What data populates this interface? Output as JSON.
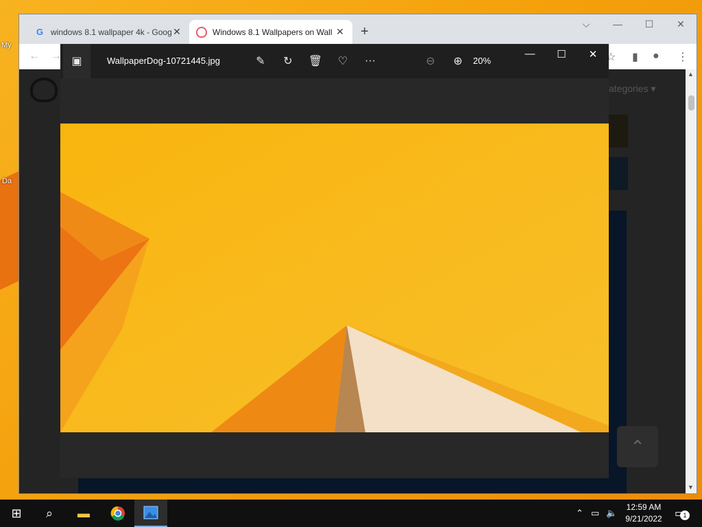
{
  "desktop": {
    "icon_labels": [
      "My",
      "Da"
    ]
  },
  "browser": {
    "tabs": [
      {
        "title": "windows 8.1 wallpaper 4k - Goog",
        "close": "✕",
        "favicon": "google-icon"
      },
      {
        "title": "Windows 8.1 Wallpapers on Wall",
        "close": "✕",
        "favicon": "wallpaperdog-icon"
      }
    ],
    "new_tab": "+",
    "window_controls": {
      "tabs_list": "⌵",
      "minimize": "—",
      "maximize": "☐",
      "close": "✕"
    },
    "page": {
      "categories_label": "ategories ▾",
      "scroll_top_symbol": "⌃"
    }
  },
  "photos": {
    "file_name": "WallpaperDog-10721445.jpg",
    "zoom": "20%",
    "toolbar_icons": [
      "edit-icon",
      "rotate-icon",
      "delete-icon",
      "favorite-icon",
      "more-icon",
      "zoom-out-icon",
      "zoom-in-icon"
    ],
    "more_label": "···"
  },
  "taskbar": {
    "time": "12:59 AM",
    "date": "9/21/2022",
    "notifications_count": "1",
    "apps": [
      "start-icon",
      "search-icon",
      "file-explorer-icon",
      "chrome-icon",
      "photos-icon"
    ]
  },
  "colors": {
    "wallpaper": "#fbbb13",
    "viewer_bg": "#282828",
    "taskbar": "#101010"
  }
}
